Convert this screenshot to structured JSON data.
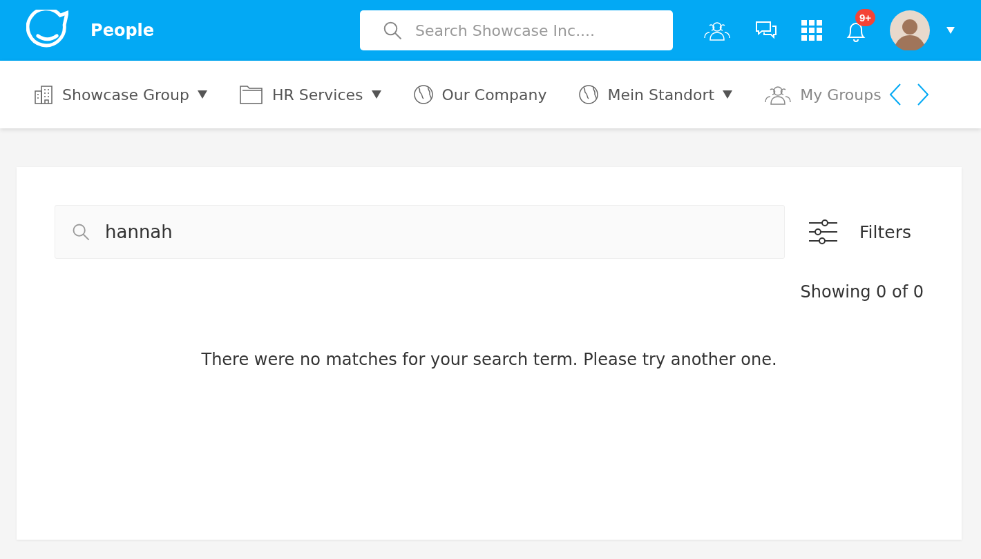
{
  "header": {
    "title": "People",
    "search": {
      "placeholder": "Search Showcase Inc...."
    },
    "notifications_badge": "9+"
  },
  "nav": {
    "items": [
      {
        "label": "Showcase Group",
        "kind": "building",
        "dropdown": true
      },
      {
        "label": "HR Services",
        "kind": "folder",
        "dropdown": true
      },
      {
        "label": "Our Company",
        "kind": "globe",
        "dropdown": false
      },
      {
        "label": "Mein Standort",
        "kind": "globe",
        "dropdown": true
      },
      {
        "label": "My Groups",
        "kind": "group",
        "dropdown": false
      }
    ]
  },
  "people_search": {
    "value": "hannah",
    "filters_label": "Filters",
    "count": "Showing 0 of 0",
    "empty_message": "There were no matches for your search term. Please try another one."
  }
}
